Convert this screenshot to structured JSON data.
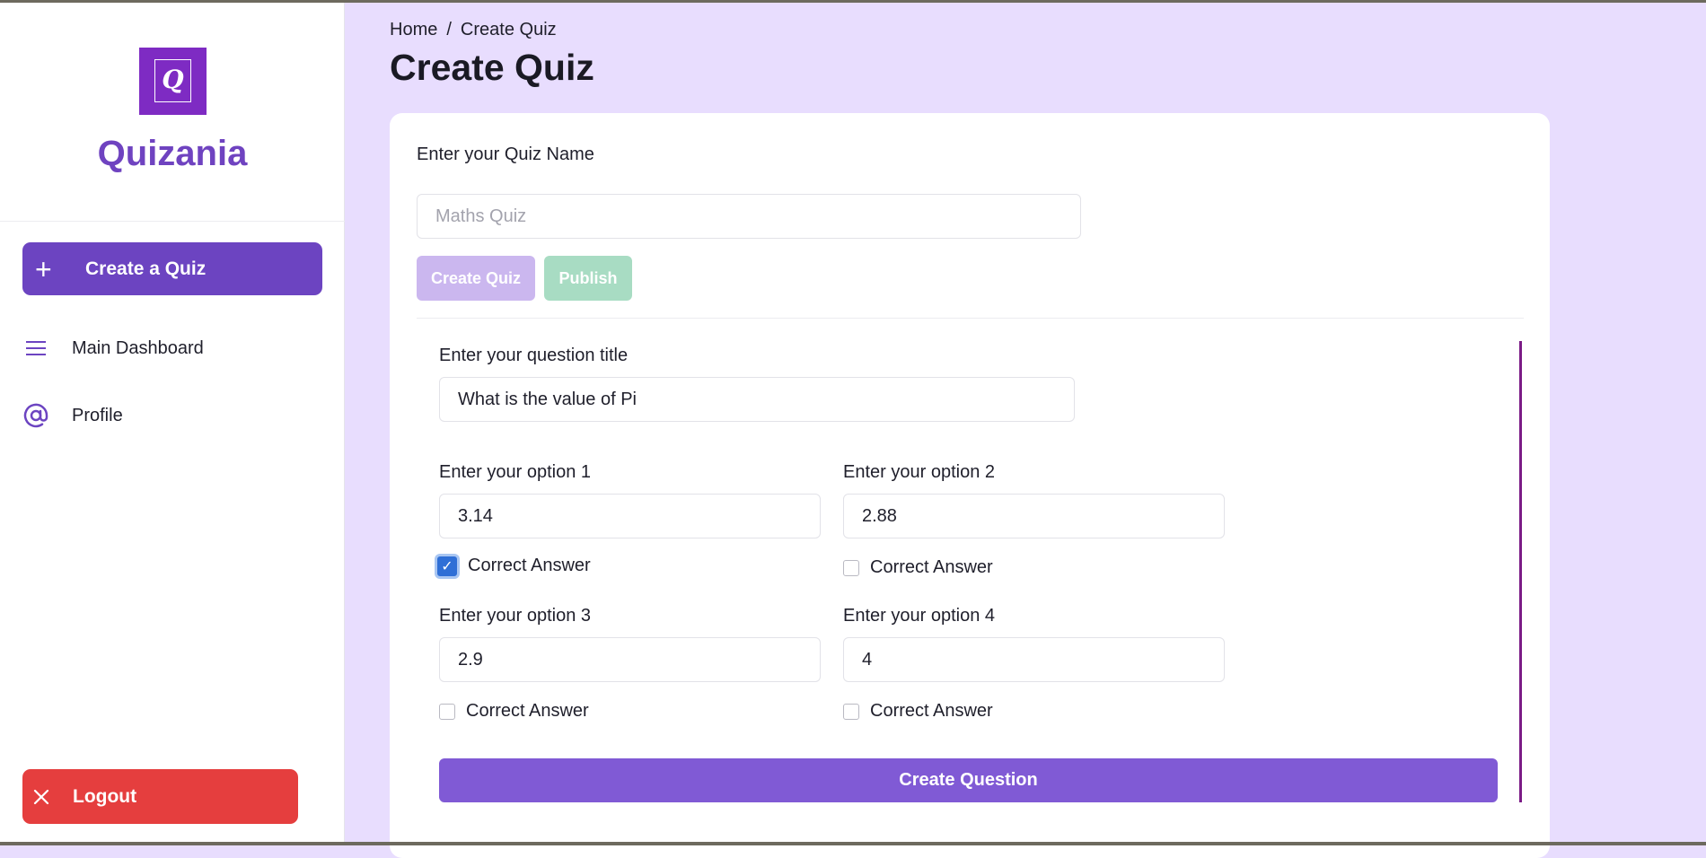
{
  "app": {
    "brand": "Quizania",
    "logo_letter": "Q"
  },
  "sidebar": {
    "create_button": {
      "icon": "plus-icon",
      "label": "Create a Quiz"
    },
    "items": [
      {
        "icon": "menu-icon",
        "label": "Main Dashboard"
      },
      {
        "icon": "at-sign-icon",
        "label": "Profile"
      }
    ],
    "logout": {
      "icon": "close-icon",
      "label": "Logout"
    }
  },
  "breadcrumb": {
    "home": "Home",
    "separator": "/",
    "current": "Create Quiz"
  },
  "page": {
    "title": "Create Quiz"
  },
  "quiz_form": {
    "name_label": "Enter your Quiz Name",
    "name_value": "",
    "name_placeholder": "Maths Quiz",
    "create_quiz_label": "Create Quiz",
    "publish_label": "Publish"
  },
  "question_form": {
    "title_label": "Enter your question title",
    "title_value": "What is the value of Pi",
    "options": [
      {
        "label": "Enter your option 1",
        "value": "3.14",
        "correct_label": "Correct Answer",
        "correct": true
      },
      {
        "label": "Enter your option 2",
        "value": "2.88",
        "correct_label": "Correct Answer",
        "correct": false
      },
      {
        "label": "Enter your option 3",
        "value": "2.9",
        "correct_label": "Correct Answer",
        "correct": false
      },
      {
        "label": "Enter your option 4",
        "value": "4",
        "correct_label": "Correct Answer",
        "correct": false
      }
    ],
    "submit_label": "Create Question"
  },
  "colors": {
    "accent": "#6c44c1",
    "background": "#e8ddfe",
    "logout": "#e53e3e",
    "create_quiz_disabled": "#cbb7ef",
    "publish_disabled": "#a8dcc3",
    "create_question": "#805ad5"
  }
}
